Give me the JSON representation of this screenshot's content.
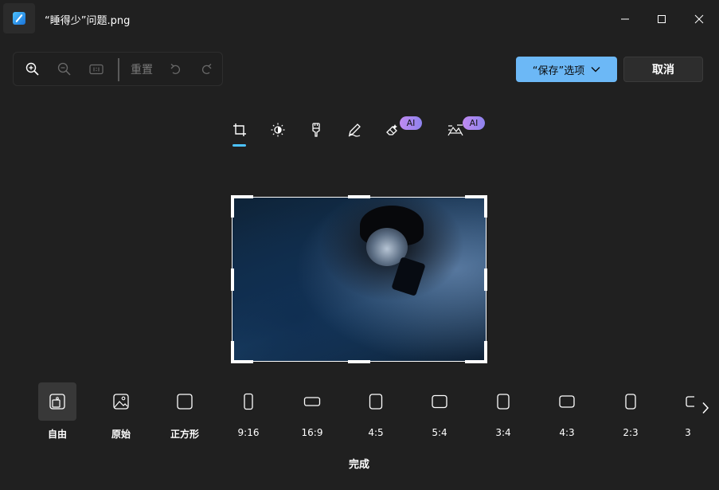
{
  "window": {
    "title": "“睡得少”问题.png"
  },
  "toolbar": {
    "reset_label": "重置"
  },
  "actions": {
    "save_label": "“保存”选项",
    "cancel_label": "取消",
    "done_label": "完成"
  },
  "modes": {
    "items": [
      {
        "icon": "crop-icon",
        "active": true
      },
      {
        "icon": "brightness-icon"
      },
      {
        "icon": "markup-icon"
      },
      {
        "icon": "pen-icon"
      },
      {
        "icon": "erase-icon",
        "badge": "AI"
      },
      {
        "icon": "background-blur-icon",
        "badge": "AI"
      }
    ]
  },
  "ratios": {
    "items": [
      {
        "label": "自由",
        "active": true
      },
      {
        "label": "原始"
      },
      {
        "label": "正方形"
      },
      {
        "label": "9:16"
      },
      {
        "label": "16:9"
      },
      {
        "label": "4:5"
      },
      {
        "label": "5:4"
      },
      {
        "label": "3:4"
      },
      {
        "label": "4:3"
      },
      {
        "label": "2:3"
      },
      {
        "label": "3"
      }
    ]
  },
  "colors": {
    "accent": "#4cc2ff",
    "save_button": "#6cb8f6",
    "background": "#202020"
  }
}
